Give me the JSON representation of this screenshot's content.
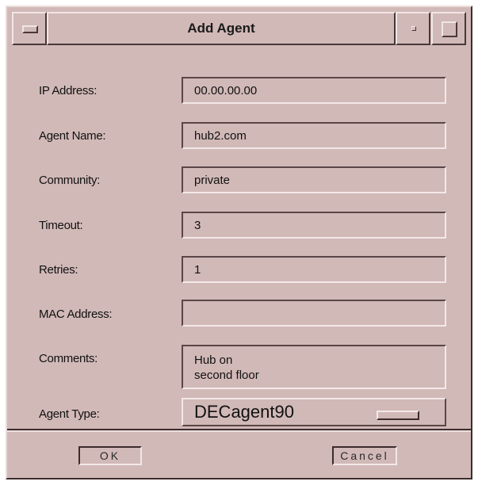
{
  "window": {
    "title": "Add Agent"
  },
  "form": {
    "ip_address": {
      "label": "IP Address:",
      "value": "00.00.00.00"
    },
    "agent_name": {
      "label": "Agent Name:",
      "value": "hub2.com"
    },
    "community": {
      "label": "Community:",
      "value": "private"
    },
    "timeout": {
      "label": "Timeout:",
      "value": "3"
    },
    "retries": {
      "label": "Retries:",
      "value": "1"
    },
    "mac_address": {
      "label": "MAC Address:",
      "value": ""
    },
    "comments": {
      "label": "Comments:",
      "line1": "Hub on",
      "line2": "second floor"
    },
    "agent_type": {
      "label": "Agent Type:",
      "value": "DECagent90"
    }
  },
  "buttons": {
    "ok": "OK",
    "cancel": "Cancel"
  }
}
